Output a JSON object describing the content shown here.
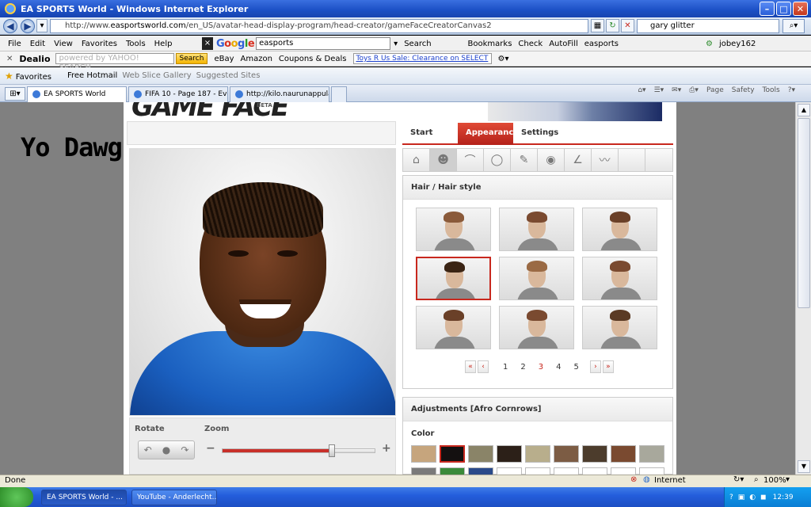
{
  "window": {
    "title": "EA SPORTS World - Windows Internet Explorer"
  },
  "address": {
    "url_prefix": "http://www.",
    "url_domain": "easportsworld.com",
    "url_path": "/en_US/avatar-head-display-program/head-creator/gameFaceCreatorCanvas2",
    "search_value": "gary glitter"
  },
  "menu": [
    "File",
    "Edit",
    "View",
    "Favorites",
    "Tools",
    "Help"
  ],
  "google_bar": {
    "input_value": "easports",
    "items": [
      "Search",
      "Bookmarks",
      "Check",
      "AutoFill",
      "easports",
      "jobey162"
    ]
  },
  "dealio_bar": {
    "brand": "Dealio",
    "yahoo_placeholder": "powered by YAHOO! SEARCH",
    "search_label": "Search",
    "links": [
      "eBay",
      "Amazon",
      "Coupons & Deals"
    ],
    "toys_link": "Toys R Us Sale: Clearance on SELECT"
  },
  "favorites_bar": {
    "label": "Favorites",
    "items": [
      "Free Hotmail",
      "Web Slice Gallery",
      "Suggested Sites"
    ]
  },
  "tabs": [
    "EA SPORTS World",
    "FIFA 10 - Page 187 - Evo-W...",
    "http://kilo.naurunappula.com..."
  ],
  "tab_tools": [
    "Page",
    "Safety",
    "Tools"
  ],
  "overlay_text": "Yo Dawg",
  "gameface": {
    "banner_beta": "BETA",
    "tabs": [
      "Start",
      "Appearance",
      "Settings"
    ],
    "active_tab": "Appearance",
    "breadcrumb": "Hair  /  Hair style",
    "pager": {
      "pages": [
        "1",
        "2",
        "3",
        "4",
        "5"
      ],
      "current": "3"
    },
    "controls": {
      "rotate_label": "Rotate",
      "zoom_label": "Zoom",
      "zoom_level": 0.72
    },
    "adjustments_title": "Adjustments [Afro Cornrows]",
    "color_label": "Color",
    "hair_colors": [
      "#c6a57d",
      "#141010",
      "#8a8468",
      "#2c2018",
      "#b8ae8c",
      "#7c5c44",
      "#4c3c2c",
      "#7a4a30",
      "#a8a89c"
    ],
    "hair_colors_row2": [
      "#7a7a7a",
      "#3a8a3a",
      "#2a4a8a",
      "#ffffff",
      "#ffffff",
      "#ffffff",
      "#ffffff",
      "#ffffff",
      "#ffffff"
    ],
    "selected_color_index": 1,
    "selected_style_index": 3,
    "style_hair_colors": [
      "#8a5a3a",
      "#7a4a30",
      "#6a4028",
      "#3a2414",
      "#9a6a44",
      "#7a4a30",
      "#6a4028",
      "#7a4a30",
      "#5a3a24"
    ]
  },
  "status": {
    "left": "Done",
    "zone": "Internet",
    "zoom": "100%"
  },
  "taskbar": {
    "tasks": [
      "EA SPORTS World - ...",
      "YouTube - Anderlecht..."
    ],
    "clock": "12:39"
  }
}
